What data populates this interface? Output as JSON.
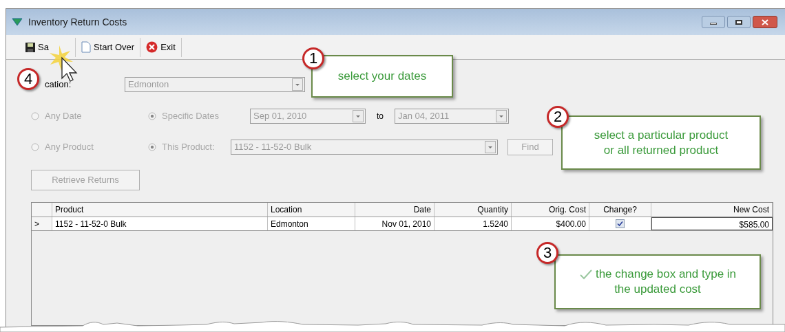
{
  "window": {
    "title": "Inventory Return Costs"
  },
  "toolbar": [
    {
      "kind": "save",
      "label": "Sa"
    },
    {
      "kind": "new",
      "label": "Start Over"
    },
    {
      "kind": "exit",
      "label": "Exit"
    }
  ],
  "filters": {
    "disabled": true,
    "location": {
      "label": "cation:",
      "value": "Edmonton"
    },
    "date_options": [
      {
        "label": "Any Date",
        "selected": false
      },
      {
        "label": "Specific Dates",
        "selected": true
      }
    ],
    "date_from": "Sep 01, 2010",
    "to_label": "to",
    "date_to": "Jan 04, 2011",
    "product_options": [
      {
        "label": "Any Product",
        "selected": false
      },
      {
        "label": "This Product:",
        "selected": true
      }
    ],
    "product": "1152 - 11-52-0 Bulk",
    "find": "Find",
    "retrieve": "Retrieve Returns"
  },
  "table": {
    "columns": [
      "Product",
      "Location",
      "Date",
      "Quantity",
      "Orig. Cost",
      "Change?",
      "New Cost"
    ],
    "rows": [
      {
        "indicator": ">",
        "product": "1152 - 11-52-0 Bulk",
        "location": "Edmonton",
        "date": "Nov 01, 2010",
        "quantity": "1.5240",
        "orig_cost": "$400.00",
        "change": true,
        "new_cost": "$585.00"
      }
    ]
  },
  "callouts": [
    {
      "number": "1",
      "lines": [
        "select your dates"
      ]
    },
    {
      "number": "2",
      "lines": [
        "select a particular product",
        "or all returned product"
      ]
    },
    {
      "number": "3",
      "lines": [
        "the change box and type in",
        "the updated cost"
      ]
    },
    {
      "number": "4"
    }
  ]
}
